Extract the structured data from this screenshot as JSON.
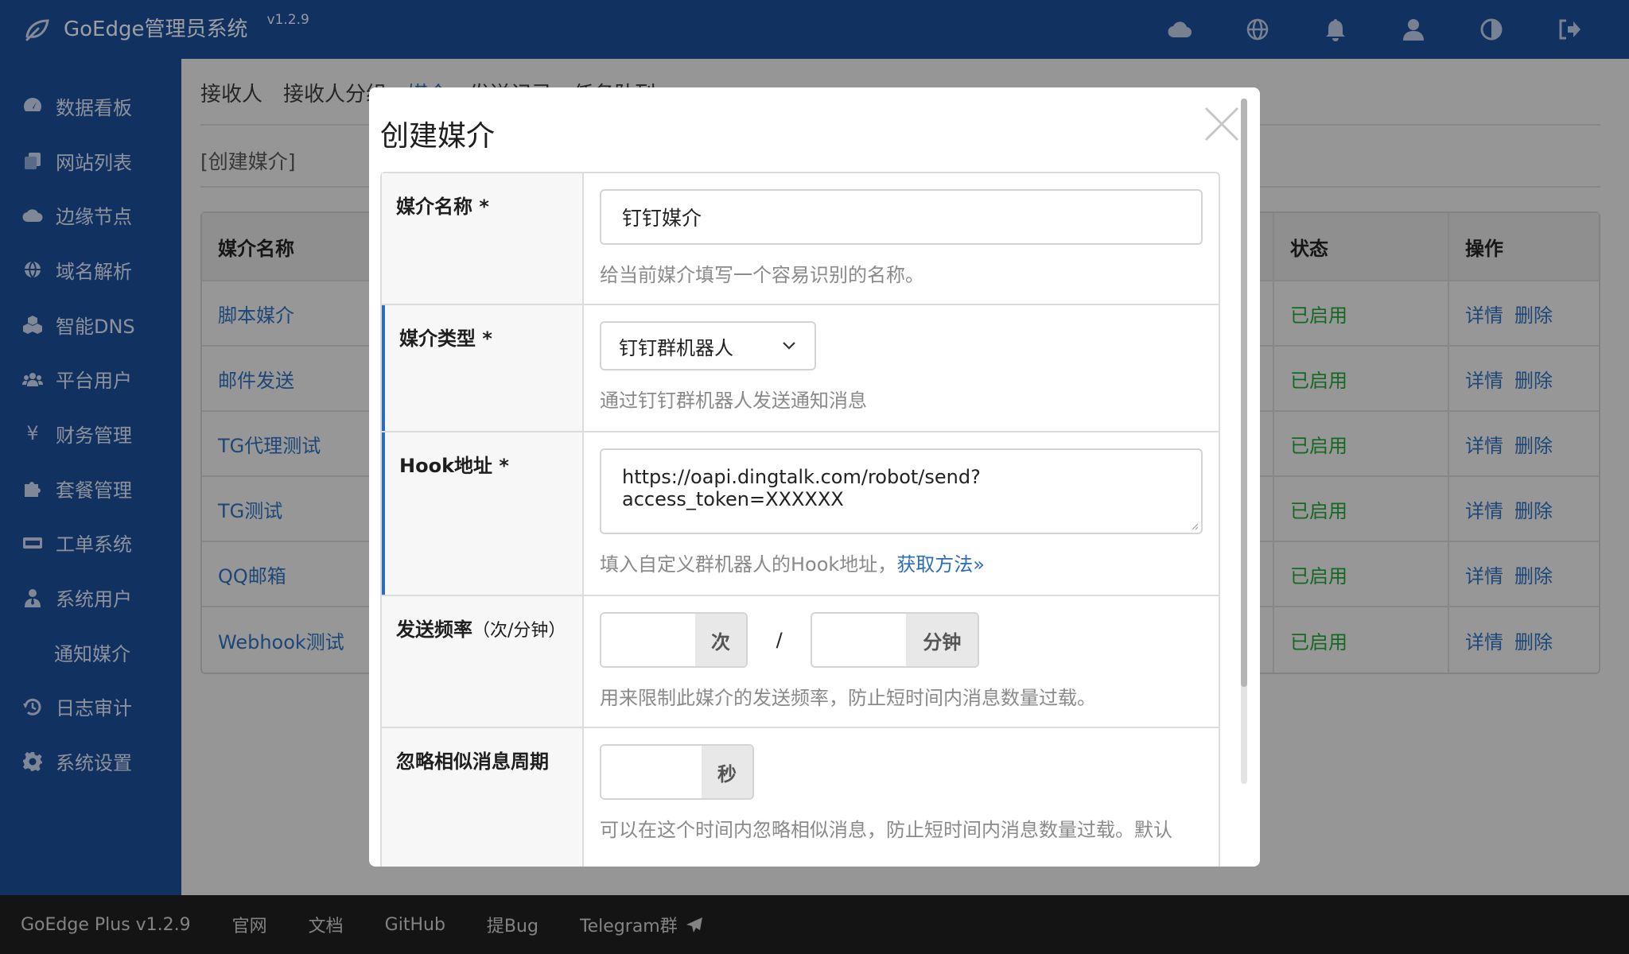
{
  "app": {
    "title": "GoEdge管理员系统",
    "version": "v1.2.9"
  },
  "topbar": {
    "icons": [
      "cloud-icon",
      "globe-icon",
      "bell-icon",
      "user-icon",
      "theme-icon",
      "logout-icon"
    ]
  },
  "sidebar": {
    "items": [
      {
        "label": "数据看板",
        "icon": "dashboard-icon"
      },
      {
        "label": "网站列表",
        "icon": "copy-icon"
      },
      {
        "label": "边缘节点",
        "icon": "cloud-icon"
      },
      {
        "label": "域名解析",
        "icon": "globe-icon"
      },
      {
        "label": "智能DNS",
        "icon": "cubes-icon"
      },
      {
        "label": "平台用户",
        "icon": "users-icon"
      },
      {
        "label": "财务管理",
        "icon": "yen-icon"
      },
      {
        "label": "套餐管理",
        "icon": "puzzle-icon"
      },
      {
        "label": "工单系统",
        "icon": "keyboard-icon"
      },
      {
        "label": "系统用户",
        "icon": "user-tie-icon"
      },
      {
        "label": "通知媒介",
        "icon": ""
      },
      {
        "label": "日志审计",
        "icon": "history-icon"
      },
      {
        "label": "系统设置",
        "icon": "cog-icon"
      }
    ]
  },
  "main": {
    "tabs": [
      {
        "label": "接收人"
      },
      {
        "label": "接收人分组"
      },
      {
        "label": "媒介"
      },
      {
        "label": "发送记录"
      },
      {
        "label": "任务队列"
      }
    ],
    "subbar": "[创建媒介]",
    "table": {
      "headers": {
        "name": "媒介名称",
        "status": "状态",
        "ops": "操作"
      },
      "rows": [
        {
          "name": "脚本媒介",
          "status": "已启用",
          "detail": "详情",
          "delete": "删除"
        },
        {
          "name": "邮件发送",
          "status": "已启用",
          "detail": "详情",
          "delete": "删除"
        },
        {
          "name": "TG代理测试",
          "status": "已启用",
          "detail": "详情",
          "delete": "删除"
        },
        {
          "name": "TG测试",
          "status": "已启用",
          "detail": "详情",
          "delete": "删除"
        },
        {
          "name": "QQ邮箱",
          "status": "已启用",
          "detail": "详情",
          "delete": "删除"
        },
        {
          "name": "Webhook测试",
          "status": "已启用",
          "detail": "详情",
          "delete": "删除"
        }
      ]
    }
  },
  "modal": {
    "title": "创建媒介",
    "fields": {
      "name": {
        "label": "媒介名称 *",
        "value": "钉钉媒介",
        "hint": "给当前媒介填写一个容易识别的名称。"
      },
      "type": {
        "label": "媒介类型 *",
        "value": "钉钉群机器人",
        "hint": "通过钉钉群机器人发送通知消息"
      },
      "hook": {
        "label": "Hook地址 *",
        "value": "https://oapi.dingtalk.com/robot/send?access_token=XXXXXX",
        "hint": "填入自定义群机器人的Hook地址，",
        "hint_link": "获取方法»"
      },
      "rate": {
        "label": "发送频率",
        "label_suffix": "（次/分钟）",
        "unit_count": "次",
        "slash": "/",
        "unit_minute": "分钟",
        "hint": "用来限制此媒介的发送频率，防止短时间内消息数量过载。"
      },
      "ignore": {
        "label": "忽略相似消息周期",
        "unit": "秒",
        "hint": "可以在这个时间内忽略相似消息，防止短时间内消息数量过载。默认"
      }
    }
  },
  "footer": {
    "items": [
      "GoEdge Plus v1.2.9",
      "官网",
      "文档",
      "GitHub",
      "提Bug",
      "Telegram群"
    ]
  }
}
